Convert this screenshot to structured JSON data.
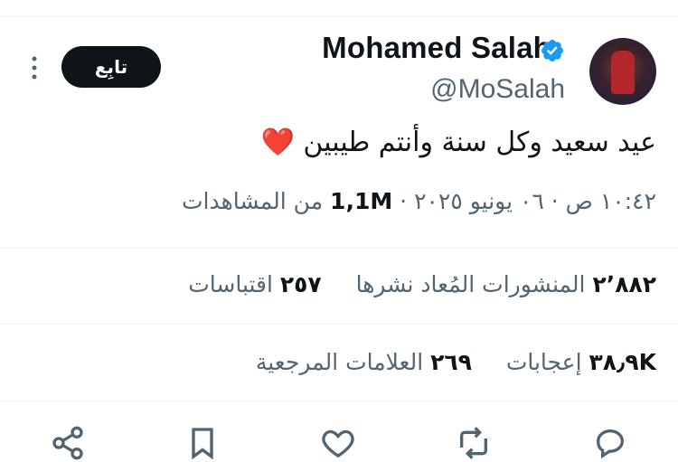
{
  "user": {
    "name": "Mohamed Salah",
    "handle": "@MoSalah"
  },
  "follow_button": {
    "label": "تابِع"
  },
  "tweet": {
    "text": "عيد سعيد وكل سنة وأنتم طيبين",
    "emoji": "❤️"
  },
  "meta": {
    "time_date": "١٠:٤٢ ص · ٠٦ يونيو ٢٠٢٥ ·",
    "views_count": "1,1M",
    "views_label": "من المشاهدات"
  },
  "stats": {
    "reposts_count": "٢٬٨٨٢",
    "reposts_label": "المنشورات المُعاد نشرها",
    "quotes_count": "٢٥٧",
    "quotes_label": "اقتباسات",
    "likes_count": "٣٨٫٩K",
    "likes_label": "إعجابات",
    "bookmarks_count": "٢٦٩",
    "bookmarks_label": "العلامات المرجعية"
  },
  "icons": {
    "verified": "verified-badge-icon",
    "more": "more-vertical-icon",
    "actions": [
      "share-icon",
      "bookmark-icon",
      "like-icon",
      "repost-icon",
      "reply-icon"
    ]
  },
  "colors": {
    "verified": "#1d9bf0",
    "text": "#0f1419",
    "secondary": "#536471",
    "heart": "#e0245e"
  }
}
